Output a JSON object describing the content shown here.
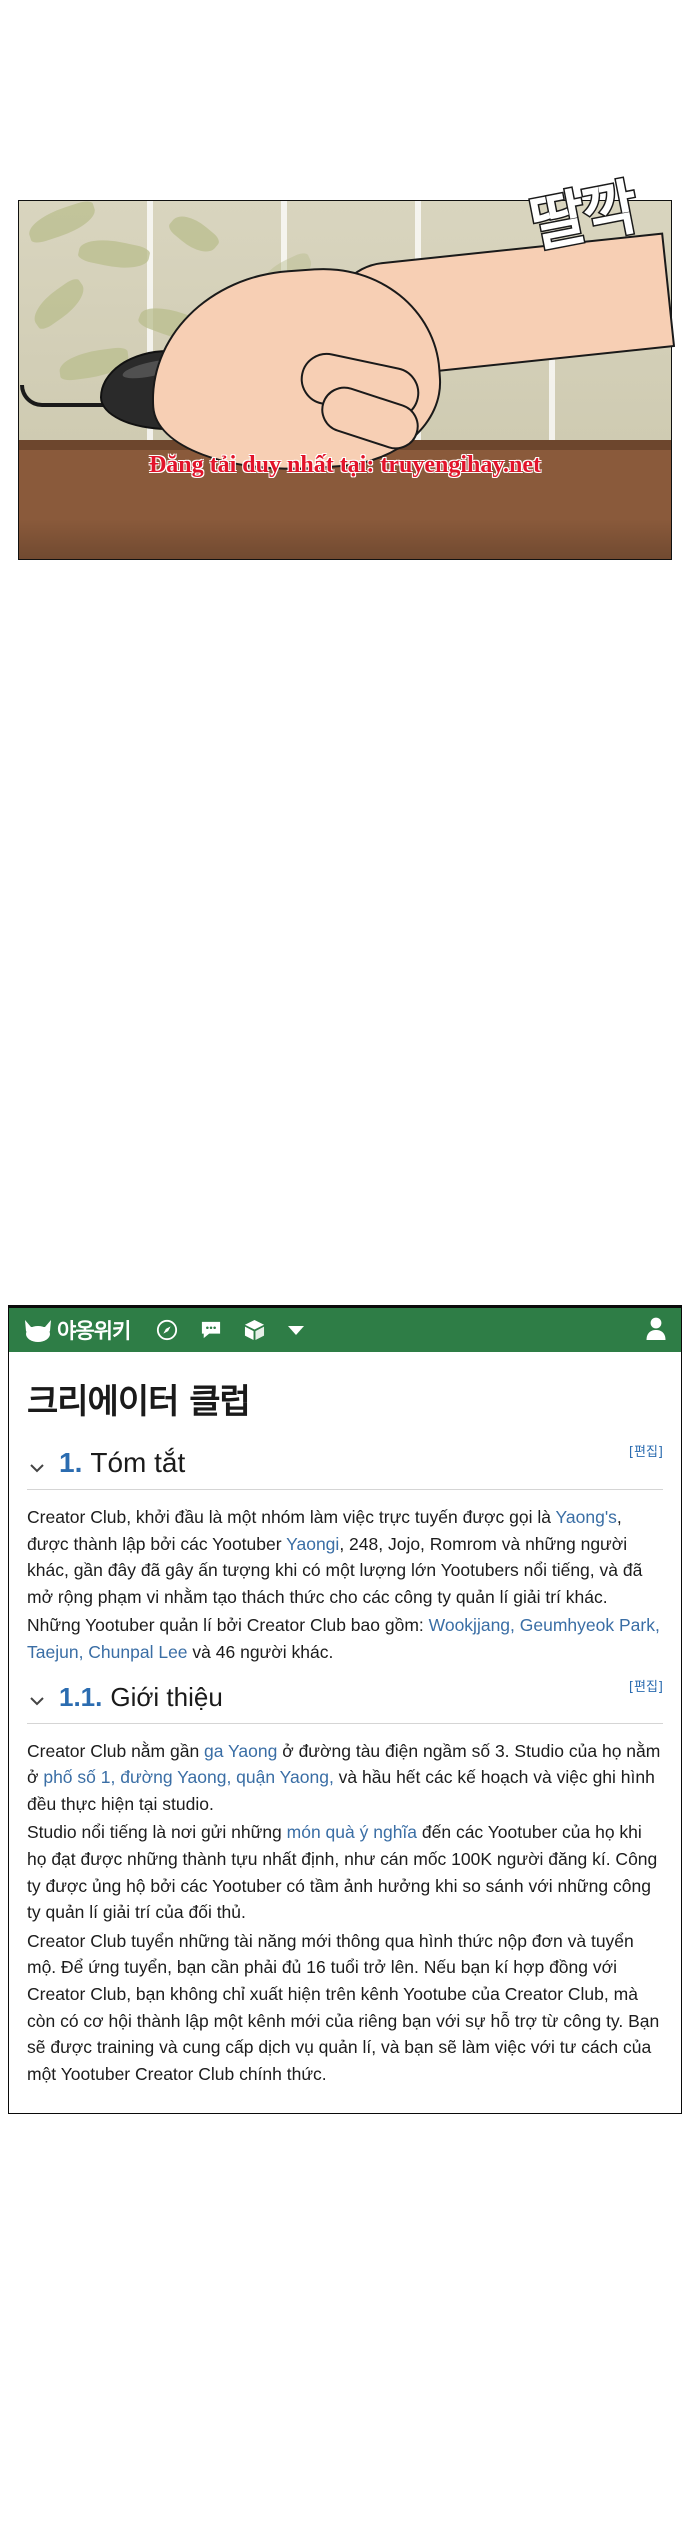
{
  "comic": {
    "sfx_text": "딸깍",
    "watermark": "Đăng tải duy nhất tại: truyengihay.net",
    "watermark_color": "#e2132a",
    "panel_description": "hand-on-mouse-panel"
  },
  "wiki": {
    "header": {
      "logo_icon": "cat-logo-icon",
      "brand_name": "야옹위키",
      "icons": [
        {
          "name": "compass-icon"
        },
        {
          "name": "chat-bubble-icon"
        },
        {
          "name": "cube-icon"
        },
        {
          "name": "chevron-down-icon"
        },
        {
          "name": "user-account-icon"
        }
      ],
      "background_color": "#2e7d46"
    },
    "page_title": "크리에이터 클럽",
    "edit_label": "[편집]",
    "sections": [
      {
        "number": "1.",
        "title": "Tóm tắt",
        "edit": "[편집]",
        "paragraphs": [
          {
            "parts": [
              {
                "t": "Creator Club, khởi đầu là một nhóm làm việc trực tuyến được gọi là ",
                "link": false
              },
              {
                "t": "Yaong's",
                "link": true
              },
              {
                "t": ", được thành lập bởi các Yootuber ",
                "link": false
              },
              {
                "t": "Yaongi",
                "link": true
              },
              {
                "t": ", 248, Jojo, Romrom và những người khác, gần đây đã gây ấn tượng khi có một lượng lớn Yootubers nổi tiếng, và đã mở rộng phạm vi nhằm tạo thách thức cho các công ty quản lí giải trí khác.",
                "link": false
              }
            ]
          },
          {
            "parts": [
              {
                "t": "Những Yootuber quản lí bởi Creator Club bao gồm: ",
                "link": false
              },
              {
                "t": "Wookjjang, Geumhyeok Park, Taejun, Chunpal Lee",
                "link": true
              },
              {
                "t": " và 46 người khác.",
                "link": false
              }
            ]
          }
        ]
      },
      {
        "number": "1.1.",
        "title": "Giới thiệu",
        "edit": "[편집]",
        "paragraphs": [
          {
            "parts": [
              {
                "t": "Creator Club nằm gần ",
                "link": false
              },
              {
                "t": "ga Yaong",
                "link": true
              },
              {
                "t": " ở đường tàu điện ngầm số 3. Studio của họ nằm ở ",
                "link": false
              },
              {
                "t": "phố số 1, đường Yaong, quận Yaong,",
                "link": true
              },
              {
                "t": " và hầu hết các kế hoạch và việc ghi hình đều thực hiện tại studio.",
                "link": false
              }
            ]
          },
          {
            "parts": [
              {
                "t": "Studio nổi tiếng là nơi gửi những ",
                "link": false
              },
              {
                "t": "món quà ý nghĩa",
                "link": true
              },
              {
                "t": " đến các Yootuber của họ khi họ đạt được những thành tựu nhất định, như cán mốc 100K người đăng kí. Công ty được ủng hộ bởi các Yootuber có tầm ảnh hưởng khi so sánh với những công ty quản lí giải trí của đối thủ.",
                "link": false
              }
            ]
          },
          {
            "parts": [
              {
                "t": "Creator Club tuyển những tài năng mới thông qua hình thức nộp đơn và tuyển mộ. Để ứng tuyển, bạn cần phải đủ 16 tuổi trở lên. Nếu bạn kí hợp đồng với Creator Club, bạn không chỉ xuất hiện trên kênh Yootube của Creator Club, mà còn có cơ hội thành lập một kênh mới của riêng bạn với sự hỗ trợ từ công ty. Bạn sẽ được training và cung cấp dịch vụ quản lí, và bạn sẽ làm việc với tư cách của một Yootuber Creator Club chính thức.",
                "link": false
              }
            ]
          }
        ]
      }
    ]
  }
}
